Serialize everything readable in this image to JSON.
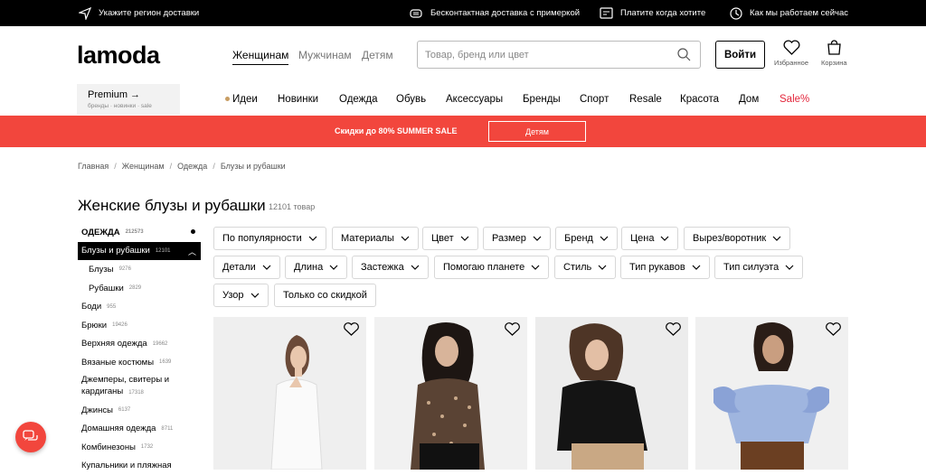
{
  "topbar": {
    "region": "Укажите регион доставки",
    "delivery": "Бесконтактная доставка с примеркой",
    "pay": "Платите когда хотите",
    "hours": "Как мы работаем сейчас"
  },
  "header": {
    "logo": "lamoda",
    "genders": [
      "Женщинам",
      "Мужчинам",
      "Детям"
    ],
    "search_placeholder": "Товар, бренд или цвет",
    "login": "Войти",
    "favorites": "Избранное",
    "cart": "Корзина",
    "premium_title": "Premium →",
    "premium_sub": "бренды · новинки · sale"
  },
  "catnav": [
    "Идеи",
    "Новинки",
    "Одежда",
    "Обувь",
    "Аксессуары",
    "Бренды",
    "Спорт",
    "Resale",
    "Красота",
    "Дом",
    "Sale%"
  ],
  "promo": {
    "text": "Скидки до 80% SUMMER SALE",
    "button": "Детям"
  },
  "breadcrumbs": [
    "Главная",
    "Женщинам",
    "Одежда",
    "Блузы и рубашки"
  ],
  "page": {
    "title": "Женские блузы и рубашки",
    "count": "12101 товар"
  },
  "sidebar": [
    {
      "label": "ОДЕЖДА",
      "count": "212573"
    },
    {
      "label": "Блузы и рубашки",
      "count": "12101"
    },
    {
      "label": "Блузы",
      "count": "9276"
    },
    {
      "label": "Рубашки",
      "count": "2829"
    },
    {
      "label": "Боди",
      "count": "955"
    },
    {
      "label": "Брюки",
      "count": "19426"
    },
    {
      "label": "Верхняя одежда",
      "count": "19662"
    },
    {
      "label": "Вязаные костюмы",
      "count": "1639"
    },
    {
      "label": "Джемперы, свитеры и кардиганы",
      "count": "17318"
    },
    {
      "label": "Джинсы",
      "count": "6137"
    },
    {
      "label": "Домашняя одежда",
      "count": "8711"
    },
    {
      "label": "Комбинезоны",
      "count": "1732"
    },
    {
      "label": "Купальники и пляжная",
      "count": ""
    }
  ],
  "filters": [
    "По популярности",
    "Материалы",
    "Цвет",
    "Размер",
    "Бренд",
    "Цена",
    "Вырез/воротник",
    "Детали",
    "Длина",
    "Застежка",
    "Помогаю планете",
    "Стиль",
    "Тип рукавов",
    "Тип силуэта",
    "Узор",
    "Только со скидкой"
  ],
  "colors": {
    "accent": "#f2463d",
    "sale": "#e3263b",
    "idea_dot": "#c89d63"
  }
}
